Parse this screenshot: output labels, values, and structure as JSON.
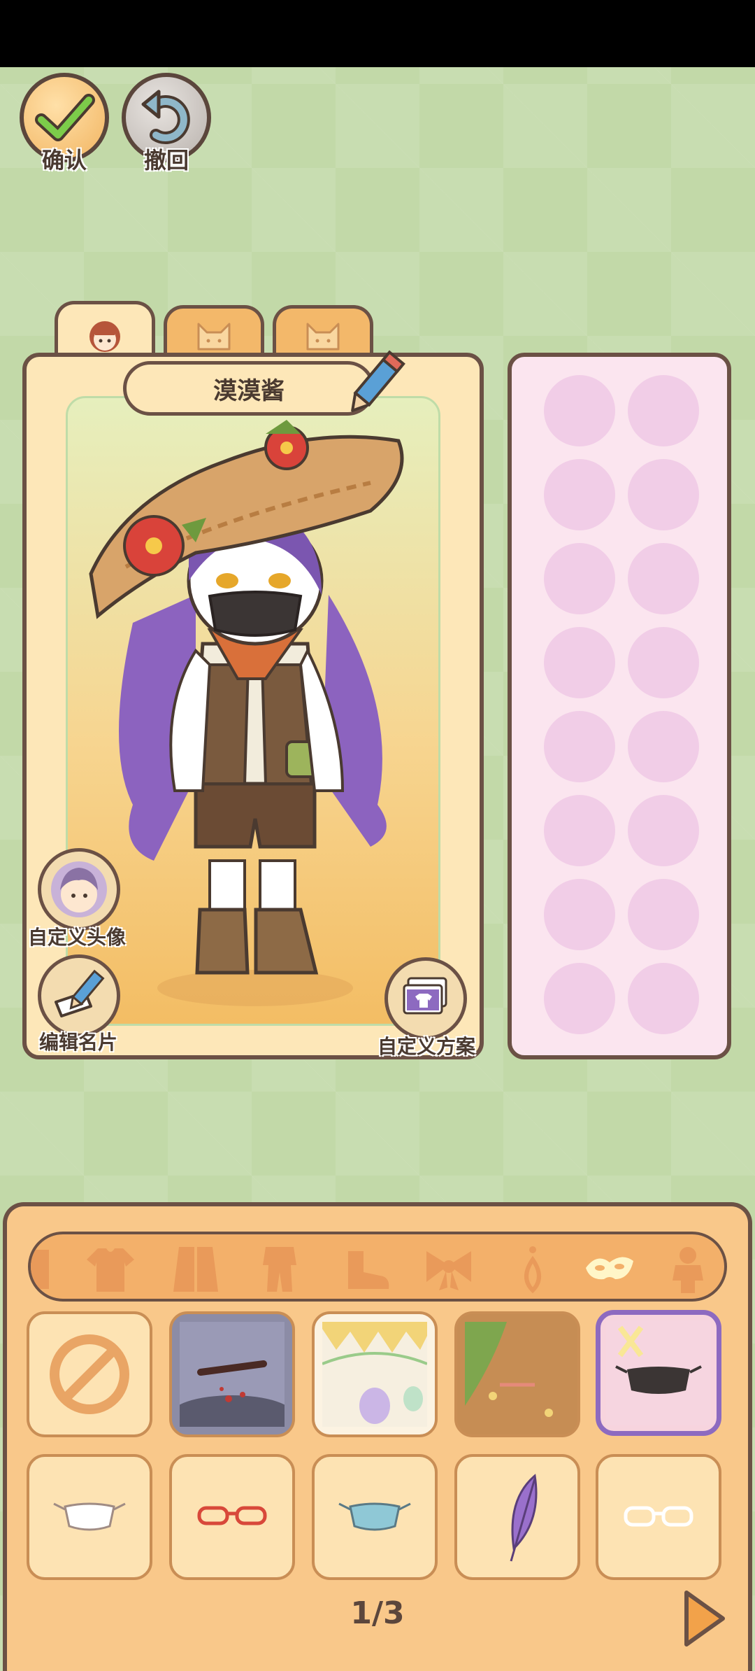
{
  "top_buttons": {
    "confirm_label": "确认",
    "undo_label": "撤回"
  },
  "tabs": [
    {
      "icon": "girl-face-icon",
      "active": true
    },
    {
      "icon": "cat-face-icon",
      "active": false
    },
    {
      "icon": "cat-face-icon",
      "active": false
    }
  ],
  "character": {
    "name": "漠漠酱"
  },
  "side_buttons": {
    "custom_avatar": "自定义头像",
    "edit_card": "编辑名片",
    "custom_outfit": "自定义方案"
  },
  "slot_panel": {
    "columns": 2,
    "rows": 8,
    "empty_slots": 16
  },
  "wardrobe": {
    "categories": [
      "partial-icon",
      "shirt-icon",
      "coat-icon",
      "outfit-icon",
      "shoe-icon",
      "bow-icon",
      "earring-icon",
      "mask-icon",
      "figure-icon"
    ],
    "active_category": "mask-icon",
    "items_row1": [
      "none-icon",
      "scene-blood-icon",
      "scene-party-icon",
      "scene-forest-icon",
      "black-mask-icon"
    ],
    "items_row2": [
      "white-mask-icon",
      "red-glasses-icon",
      "blue-mask-icon",
      "purple-feather-icon",
      "clear-glasses-icon"
    ],
    "selected_item": "black-mask-icon",
    "page": "1/3"
  },
  "colors": {
    "background": "#c2d9a8",
    "panel_border": "#6b5145",
    "card_bg": "#fde7b8",
    "slot_panel_bg": "#fbe5ef",
    "slot": "#f1cde7",
    "wardrobe_bg": "#f9c88a",
    "selected_border": "#8d6ac0"
  }
}
